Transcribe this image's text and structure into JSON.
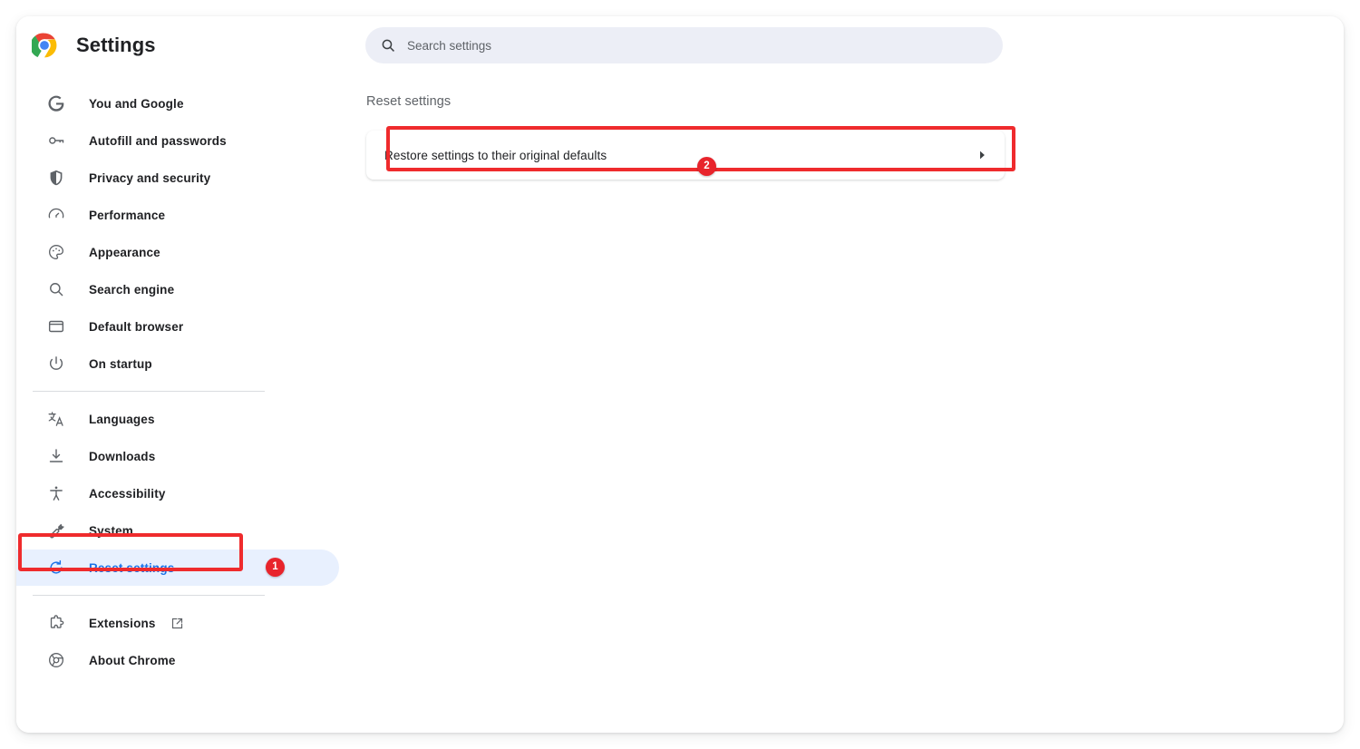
{
  "app": {
    "title": "Settings",
    "logo_icon": "chrome-logo-icon"
  },
  "search": {
    "placeholder": "Search settings",
    "value": "",
    "icon": "search-icon"
  },
  "sidebar": {
    "groups": [
      {
        "items": [
          {
            "label": "You and Google",
            "icon": "google-g-icon",
            "selected": false
          },
          {
            "label": "Autofill and passwords",
            "icon": "key-icon",
            "selected": false
          },
          {
            "label": "Privacy and security",
            "icon": "shield-icon",
            "selected": false
          },
          {
            "label": "Performance",
            "icon": "speedometer-icon",
            "selected": false
          },
          {
            "label": "Appearance",
            "icon": "palette-icon",
            "selected": false
          },
          {
            "label": "Search engine",
            "icon": "magnifier-icon",
            "selected": false
          },
          {
            "label": "Default browser",
            "icon": "browser-window-icon",
            "selected": false
          },
          {
            "label": "On startup",
            "icon": "power-icon",
            "selected": false
          }
        ]
      },
      {
        "items": [
          {
            "label": "Languages",
            "icon": "translate-icon",
            "selected": false
          },
          {
            "label": "Downloads",
            "icon": "download-icon",
            "selected": false
          },
          {
            "label": "Accessibility",
            "icon": "accessibility-icon",
            "selected": false
          },
          {
            "label": "System",
            "icon": "wrench-icon",
            "selected": false
          },
          {
            "label": "Reset settings",
            "icon": "reset-icon",
            "selected": true
          }
        ]
      },
      {
        "items": [
          {
            "label": "Extensions",
            "icon": "puzzle-piece-icon",
            "selected": false,
            "external_link_icon": "external-link-icon"
          },
          {
            "label": "About Chrome",
            "icon": "chrome-outline-icon",
            "selected": false
          }
        ]
      }
    ]
  },
  "main": {
    "section_title": "Reset settings",
    "reset_card": {
      "label": "Restore settings to their original defaults",
      "arrow_icon": "chevron-right-icon"
    }
  },
  "annotations": {
    "badge_1": "1",
    "badge_2": "2",
    "highlight_color": "#ef2b2d",
    "badge_color": "#e8242c"
  },
  "colors": {
    "accent_blue": "#1a73e8",
    "selected_bg": "#e8f0fe",
    "search_bg": "#eceef6",
    "text_primary": "#202124",
    "text_secondary": "#5f6368"
  }
}
